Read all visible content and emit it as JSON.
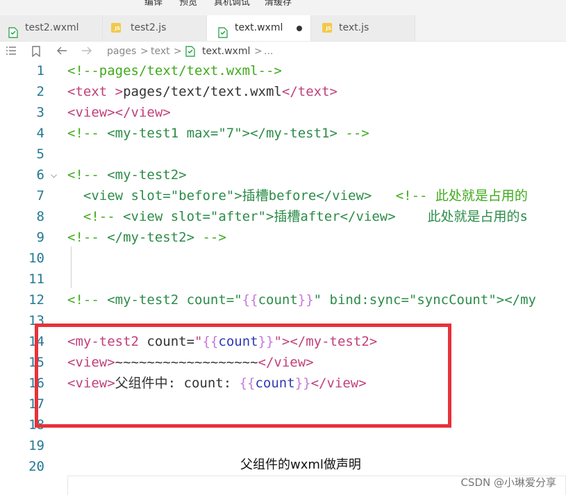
{
  "menu": [
    {
      "label": "编译"
    },
    {
      "label": "预览"
    },
    {
      "label": "真机调试"
    },
    {
      "label": "清缓存"
    }
  ],
  "tabs": [
    {
      "label": "test2.wxml",
      "icon": "wxml-file-icon",
      "active": false
    },
    {
      "label": "test2.js",
      "icon": "js-file-icon",
      "active": false
    },
    {
      "label": "text.wxml",
      "icon": "wxml-file-icon",
      "active": true,
      "unsaved": true
    },
    {
      "label": "text.js",
      "icon": "js-file-icon",
      "active": false
    }
  ],
  "icons": {
    "list": "list-icon",
    "bookmark": "bookmark-icon",
    "back": "arrow-left-icon",
    "forward": "arrow-right-icon",
    "js_badge": "JS"
  },
  "breadcrumb": {
    "parts": [
      "pages",
      "text",
      "text.wxml",
      "..."
    ],
    "sep": ">"
  },
  "lines": [
    {
      "n": "1",
      "tokens": [
        {
          "c": "comment",
          "t": "<!--pages/text/text.wxml-->"
        }
      ]
    },
    {
      "n": "2",
      "tokens": [
        {
          "c": "tag",
          "t": "<text "
        },
        {
          "c": "tag",
          "t": ">"
        },
        {
          "c": "text",
          "t": "pages/text/text.wxml"
        },
        {
          "c": "tag",
          "t": "</text>"
        }
      ]
    },
    {
      "n": "3",
      "tokens": [
        {
          "c": "tag",
          "t": "<view></view>"
        }
      ]
    },
    {
      "n": "4",
      "tokens": [
        {
          "c": "comment",
          "t": "<!-- "
        },
        {
          "c": "val",
          "t": "<my-test1 max=\"7\"></my-test1>"
        },
        {
          "c": "comment",
          "t": " -->"
        }
      ]
    },
    {
      "n": "5",
      "tokens": []
    },
    {
      "n": "6",
      "fold": true,
      "tokens": [
        {
          "c": "comment",
          "t": "<!-- "
        },
        {
          "c": "val",
          "t": "<my-test2>"
        }
      ]
    },
    {
      "n": "7",
      "tokens": [
        {
          "c": "val",
          "t": "  <view slot=\"before\">插槽before</view>   "
        },
        {
          "c": "comment",
          "t": "<!-- 此处就是占用的"
        }
      ]
    },
    {
      "n": "8",
      "tokens": [
        {
          "c": "comment",
          "t": "  <!-- "
        },
        {
          "c": "val",
          "t": "<view slot=\"after\">插槽after</view>    此处就是占用的s"
        }
      ]
    },
    {
      "n": "9",
      "tokens": [
        {
          "c": "comment",
          "t": "<!-- "
        },
        {
          "c": "val",
          "t": "</my-test2>"
        },
        {
          "c": "comment",
          "t": " -->"
        }
      ]
    },
    {
      "n": "10",
      "tokens": []
    },
    {
      "n": "11",
      "tokens": []
    },
    {
      "n": "12",
      "tokens": [
        {
          "c": "comment",
          "t": "<!-- "
        },
        {
          "c": "val",
          "t": "<my-test2 count=\""
        },
        {
          "c": "brace",
          "t": "{{"
        },
        {
          "c": "val",
          "t": "count"
        },
        {
          "c": "brace",
          "t": "}}"
        },
        {
          "c": "val",
          "t": "\" bind:sync=\"syncCount\"></my"
        }
      ]
    },
    {
      "n": "13",
      "tokens": []
    },
    {
      "n": "14",
      "tokens": [
        {
          "c": "tag",
          "t": "<my-test2 "
        },
        {
          "c": "attr",
          "t": "count"
        },
        {
          "c": "text",
          "t": "="
        },
        {
          "c": "tag",
          "t": "\""
        },
        {
          "c": "brace",
          "t": "{{"
        },
        {
          "c": "expr",
          "t": "count"
        },
        {
          "c": "brace",
          "t": "}}"
        },
        {
          "c": "tag",
          "t": "\"></my-test2>"
        }
      ]
    },
    {
      "n": "15",
      "tokens": [
        {
          "c": "tag",
          "t": "<view>"
        },
        {
          "c": "text",
          "t": "~~~~~~~~~~~~~~~~~~"
        },
        {
          "c": "tag",
          "t": "</view>"
        }
      ]
    },
    {
      "n": "16",
      "tokens": [
        {
          "c": "tag",
          "t": "<view>"
        },
        {
          "c": "text",
          "t": "父组件中: count: "
        },
        {
          "c": "brace",
          "t": "{{"
        },
        {
          "c": "expr",
          "t": "count"
        },
        {
          "c": "brace",
          "t": "}}"
        },
        {
          "c": "tag",
          "t": "</view>"
        }
      ]
    },
    {
      "n": "17",
      "tokens": []
    },
    {
      "n": "18",
      "tokens": []
    },
    {
      "n": "19",
      "tokens": []
    },
    {
      "n": "20",
      "tokens": []
    }
  ],
  "caption": "父组件的wxml做声明",
  "watermark": "CSDN @小琳爱分享",
  "colors": {
    "comment": "#3faa1c",
    "tag": "#c0407a",
    "highlight_box": "#e8313a",
    "line_number": "#237893"
  }
}
